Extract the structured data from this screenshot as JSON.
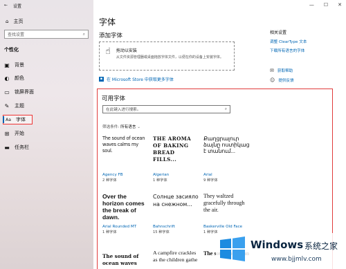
{
  "window": {
    "title": "设置",
    "back": "←",
    "min": "—",
    "max": "☐",
    "close": "✕"
  },
  "sidebar": {
    "home": "主页",
    "search_placeholder": "查找设置",
    "section": "个性化",
    "items": [
      {
        "label": "背景",
        "icon": "picture-icon"
      },
      {
        "label": "颜色",
        "icon": "palette-icon"
      },
      {
        "label": "锁屏界面",
        "icon": "monitor-icon"
      },
      {
        "label": "主题",
        "icon": "brush-icon"
      },
      {
        "label": "字体",
        "icon": "font-icon",
        "active": true
      },
      {
        "label": "开始",
        "icon": "start-icon"
      },
      {
        "label": "任务栏",
        "icon": "taskbar-icon"
      }
    ]
  },
  "main": {
    "title": "字体",
    "add_heading": "添加字体",
    "drop_title": "拖动以安装",
    "drop_desc": "从文件资源管理器或桌面拖放字体文件，以便在你的设备上安装字体。",
    "store_link": "在 Microsoft Store 中获取更多字体",
    "available_heading": "可用字体",
    "font_search_placeholder": "在此键入进行搜索。",
    "filter_label": "筛选条件:",
    "filter_value": "所有语言"
  },
  "related": {
    "heading": "相关设置",
    "links": [
      "调整 ClearType 文本",
      "下载所有语言的字体"
    ]
  },
  "help": {
    "get_help": "获取帮助",
    "feedback": "提供反馈"
  },
  "fonts": [
    {
      "sample": "The sound of ocean waves calms my soul.",
      "name": "Agency FB",
      "count": "2 种字体",
      "style": "s-agency"
    },
    {
      "sample": "THE AROMA OF BAKING BREAD FILLS...",
      "name": "Algerian",
      "count": "1 种字体",
      "style": "s-algerian"
    },
    {
      "sample": "Քաղցրալուր ձայնը ոստիկաց է տանում...",
      "name": "Arial",
      "count": "9 种字体",
      "style": "s-arial"
    },
    {
      "sample": "Over the horizon comes the break of dawn.",
      "name": "Arial Rounded MT",
      "count": "1 种字体",
      "style": "s-round"
    },
    {
      "sample": "Солнце засияло на снежном...",
      "name": "Bahnschrift",
      "count": "15 种字体",
      "style": "s-bahn"
    },
    {
      "sample": "They waltzed gracefully through the air.",
      "name": "Baskerville Old Face",
      "count": "1 种字体",
      "style": "s-bask"
    },
    {
      "sample": "The sound of ocean waves",
      "name": "",
      "count": "",
      "style": "s-bottom1"
    },
    {
      "sample": "A campfire crackles as the children gathe",
      "name": "",
      "count": "",
      "style": "s-bottom2"
    },
    {
      "sample": "The sound of ocean",
      "name": "",
      "count": "",
      "style": "s-bottom3"
    }
  ],
  "watermark": {
    "brand": "Windows",
    "sub": "系统之家",
    "url": "www.bjjmlv.com"
  }
}
